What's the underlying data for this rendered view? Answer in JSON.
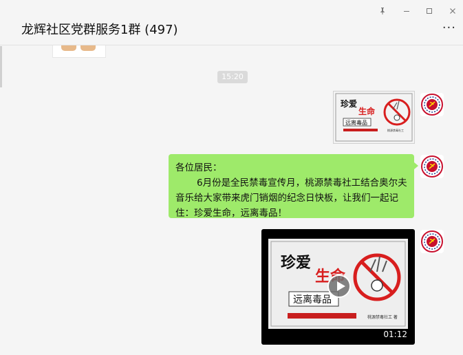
{
  "window": {
    "title": "龙辉社区党群服务1群 (497)",
    "controls": {
      "pin_icon": "pin-icon",
      "minimize_icon": "minimize-icon",
      "maximize_icon": "maximize-icon",
      "close_icon": "close-icon"
    },
    "more_label": "···"
  },
  "chat": {
    "timestamp": "15:20",
    "image_poster": {
      "title_line1": "珍爱",
      "title_line2": "生命",
      "stamp": "远离毒品",
      "footer": "桃源禁毒社工"
    },
    "text_message": {
      "greeting": "各位居民：",
      "body": "6月份是全民禁毒宣传月，桃源禁毒社工结合奥尔夫音乐给大家带来虎门销烟的纪念日快板，让我们一起记住：珍爱生命，远离毒品！"
    },
    "video": {
      "title_line1": "珍爱",
      "title_line2": "生命",
      "stamp": "远离毒品",
      "footer": "桃源禁毒社工 著",
      "duration": "01:12"
    }
  },
  "colors": {
    "bubble": "#9eea6a",
    "poster_red": "#d81e1e",
    "background": "#f5f5f5"
  }
}
